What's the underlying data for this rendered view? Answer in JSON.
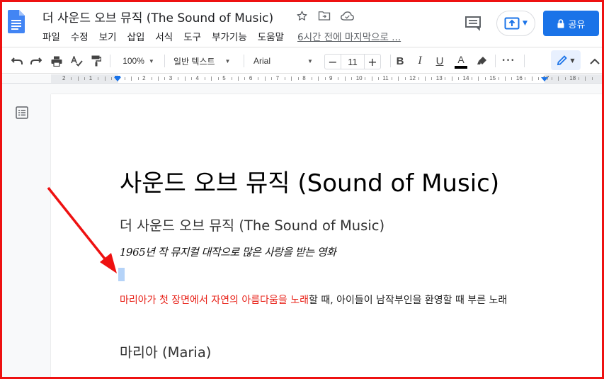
{
  "app": {
    "title": "더 사운드 오브 뮤직 (The Sound of Music)",
    "accent": "#1a73e8"
  },
  "menu": {
    "items": [
      "파일",
      "수정",
      "보기",
      "삽입",
      "서식",
      "도구",
      "부가기능",
      "도움말"
    ],
    "last_edit": "6시간 전에 마지막으로 ..."
  },
  "header_icons": [
    "star-icon",
    "move-to-folder-icon",
    "cloud-status-icon",
    "comments-icon",
    "present-icon"
  ],
  "share": {
    "label": "공유",
    "icon": "lock-icon",
    "color": "#1a73e8"
  },
  "toolbar": {
    "zoom": "100%",
    "style": "일반 텍스트",
    "font": "Arial",
    "font_size": "11",
    "minus": "−",
    "plus": "+",
    "bold": "B",
    "italic": "I",
    "underline": "U",
    "text_color": "A",
    "more": "•••"
  },
  "ruler": {
    "labels": [
      "2",
      "1",
      "1",
      "2",
      "3",
      "4",
      "5",
      "6",
      "7",
      "8",
      "9",
      "10",
      "11",
      "12",
      "13",
      "14",
      "15",
      "16",
      "17",
      "18"
    ]
  },
  "document": {
    "title": "사운드 오브 뮤직 (Sound of Music)",
    "subtitle": "더 사운드 오브 뮤직 (The Sound of Music)",
    "handwritten": "1965년 작 뮤지컬 대작으로 많은 사랑을 받는 영화",
    "body_red": "마리아가 첫 장면에서 자연의 아름다움을 노래",
    "body_rest": "할 때, 아이들이 남작부인을 환영할 때 부른 노래",
    "heading2": "마리아 (Maria)",
    "red_color": "#e8231a"
  },
  "annotation": {
    "arrow_color": "#ee1111",
    "frame_color": "#ee1111"
  }
}
